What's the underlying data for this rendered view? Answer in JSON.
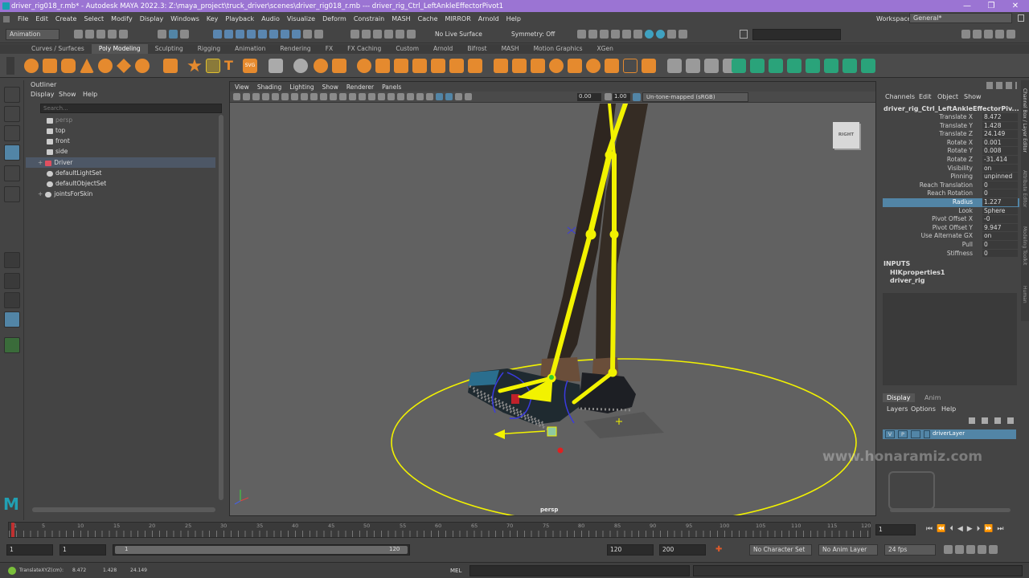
{
  "titlebar": {
    "title": "driver_rig018_r.mb* - Autodesk MAYA 2022.3: Z:\\maya_project\\truck_driver\\scenes\\driver_rig018_r.mb  ---  driver_rig_Ctrl_LeftAnkleEffectorPivot1",
    "minimize": "—",
    "maximize": "❐",
    "close": "✕"
  },
  "menubar": {
    "items": [
      "File",
      "Edit",
      "Create",
      "Select",
      "Modify",
      "Display",
      "Windows",
      "Key",
      "Playback",
      "Audio",
      "Visualize",
      "Deform",
      "Constrain",
      "MASH",
      "Cache",
      "MIRROR",
      "Arnold",
      "Help"
    ],
    "workspace_label": "Workspace:",
    "workspace_value": "General*"
  },
  "statusline": {
    "mode": "Animation",
    "live_surface": "No Live Surface",
    "symmetry": "Symmetry: Off"
  },
  "shelf": {
    "tabs": [
      "Curves / Surfaces",
      "Poly Modeling",
      "Sculpting",
      "Rigging",
      "Animation",
      "Rendering",
      "FX",
      "FX Caching",
      "Custom",
      "Arnold",
      "Bifrost",
      "MASH",
      "Motion Graphics",
      "XGen"
    ],
    "active": "Poly Modeling"
  },
  "outliner": {
    "title": "Outliner",
    "menu": [
      "Display",
      "Show",
      "Help"
    ],
    "search_placeholder": "Search...",
    "items": [
      {
        "label": "persp",
        "dim": true
      },
      {
        "label": "top"
      },
      {
        "label": "front"
      },
      {
        "label": "side"
      },
      {
        "label": "Driver",
        "selected": true,
        "expand": "+"
      },
      {
        "label": "defaultLightSet"
      },
      {
        "label": "defaultObjectSet"
      },
      {
        "label": "jointsForSkin",
        "expand": "+"
      }
    ]
  },
  "viewport": {
    "menu": [
      "View",
      "Shading",
      "Lighting",
      "Show",
      "Renderer",
      "Panels"
    ],
    "field1": "0.00",
    "field2": "1.00",
    "colorspace": "Un-tone-mapped (sRGB)",
    "camera": "persp",
    "viewcube": "RIGHT"
  },
  "channelbox": {
    "menu": [
      "Channels",
      "Edit",
      "Object",
      "Show"
    ],
    "node": "driver_rig_Ctrl_LeftAnkleEffectorPiv...",
    "channels": [
      {
        "label": "Translate X",
        "value": "8.472"
      },
      {
        "label": "Translate Y",
        "value": "1.428"
      },
      {
        "label": "Translate Z",
        "value": "24.149"
      },
      {
        "label": "Rotate X",
        "value": "0.001"
      },
      {
        "label": "Rotate Y",
        "value": "0.008"
      },
      {
        "label": "Rotate Z",
        "value": "-31.414"
      },
      {
        "label": "Visibility",
        "value": "on"
      },
      {
        "label": "Pinning",
        "value": "unpinned"
      },
      {
        "label": "Reach Translation",
        "value": "0"
      },
      {
        "label": "Reach Rotation",
        "value": "0"
      },
      {
        "label": "Radius",
        "value": "1.227",
        "highlight": true
      },
      {
        "label": "Look",
        "value": "Sphere"
      },
      {
        "label": "Pivot Offset X",
        "value": "-0"
      },
      {
        "label": "Pivot Offset Y",
        "value": "9.947"
      },
      {
        "label": "Use Alternate GX",
        "value": "on"
      },
      {
        "label": "Pull",
        "value": "0"
      },
      {
        "label": "Stiffness",
        "value": "0"
      }
    ],
    "inputs_title": "INPUTS",
    "inputs": [
      "HIKproperties1",
      "driver_rig"
    ]
  },
  "sidetabs": [
    "Channel Box / Layer Editor",
    "Attribute Editor",
    "Modeling Toolkit",
    "Human"
  ],
  "layers": {
    "tabs": [
      "Display",
      "Anim"
    ],
    "menu": [
      "Layers",
      "Options",
      "Help"
    ],
    "layer": {
      "v": "V",
      "p": "P",
      "name": "driverLayer"
    }
  },
  "watermark": "www.honaramiz.com",
  "timeline": {
    "ticks": [
      "1",
      "5",
      "10",
      "15",
      "20",
      "25",
      "30",
      "35",
      "40",
      "45",
      "50",
      "55",
      "60",
      "65",
      "70",
      "75",
      "80",
      "85",
      "90",
      "95",
      "100",
      "105",
      "110",
      "115",
      "120"
    ],
    "current": "1"
  },
  "range": {
    "start": "1",
    "start2": "1",
    "slider_start": "1",
    "slider_end": "120",
    "end": "120",
    "end2": "200",
    "char_set": "No Character Set",
    "anim_layer": "No Anim Layer",
    "fps": "24 fps"
  },
  "cmdline": {
    "readout": "TranslateXYZ(cm):",
    "tx": "8.472",
    "ty": "1.428",
    "tz": "24.149",
    "lang": "MEL"
  },
  "colors": {
    "accent": "#9b74d3",
    "selection": "#5285a6",
    "rig": "#f2f200"
  }
}
